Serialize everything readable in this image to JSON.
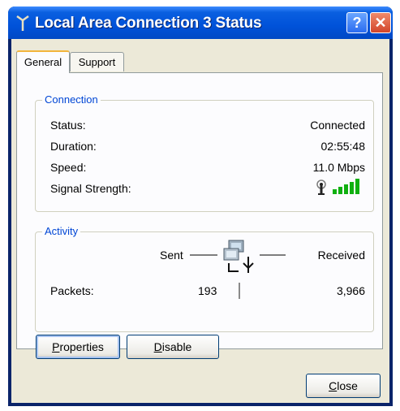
{
  "window": {
    "title": "Local Area Connection 3 Status"
  },
  "titlebar": {
    "help_glyph": "?",
    "close_glyph": "✕"
  },
  "tabs": [
    {
      "label": "General",
      "active": true
    },
    {
      "label": "Support",
      "active": false
    }
  ],
  "connection": {
    "group_title": "Connection",
    "rows": [
      {
        "label": "Status:",
        "value": "Connected"
      },
      {
        "label": "Duration:",
        "value": "02:55:48"
      },
      {
        "label": "Speed:",
        "value": "11.0 Mbps"
      },
      {
        "label": "Signal Strength:",
        "value_icon": "wireless-signal-strength-icon",
        "bars_lit": 5,
        "bars_total": 5
      }
    ]
  },
  "activity": {
    "group_title": "Activity",
    "sent_label": "Sent",
    "received_label": "Received",
    "network_icon": "network-computers-icon",
    "packets_label": "Packets:",
    "packets_sent": "193",
    "packets_received": "3,966"
  },
  "buttons": {
    "properties_mnemonic": "P",
    "properties_rest": "roperties",
    "disable_mnemonic": "D",
    "disable_rest": "isable",
    "close_mnemonic": "C",
    "close_rest": "lose"
  },
  "colors": {
    "title_bar": "#0052d9",
    "group_title": "#0046d5",
    "signal_green": "#10b010",
    "dialog_bg": "#ece9d8"
  }
}
